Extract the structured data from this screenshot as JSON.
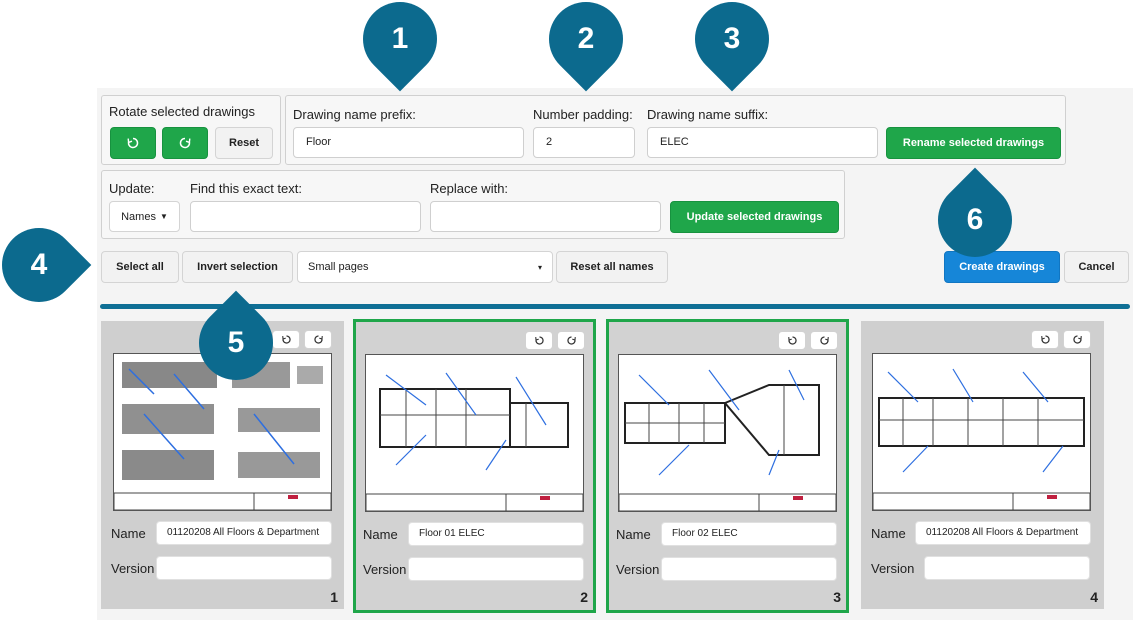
{
  "rotate": {
    "title": "Rotate selected drawings",
    "reset_label": "Reset"
  },
  "rename": {
    "prefix_label": "Drawing name prefix:",
    "prefix_value": "Floor",
    "padding_label": "Number padding:",
    "padding_value": "2",
    "suffix_label": "Drawing name suffix:",
    "suffix_value": "ELEC",
    "rename_button": "Rename selected drawings"
  },
  "update": {
    "update_label": "Update:",
    "mode_value": "Names",
    "find_label": "Find this exact text:",
    "find_value": "",
    "replace_label": "Replace with:",
    "replace_value": "",
    "update_button": "Update selected drawings"
  },
  "toolbar": {
    "select_all": "Select all",
    "invert_selection": "Invert selection",
    "page_size_value": "Small pages",
    "reset_all_names": "Reset all names",
    "create_drawings": "Create drawings",
    "cancel": "Cancel"
  },
  "cards": [
    {
      "name_label": "Name",
      "name_value": "01120208 All Floors & Department",
      "version_label": "Version",
      "version_value": "",
      "page_number": "1",
      "selected": false
    },
    {
      "name_label": "Name",
      "name_value": "Floor 01 ELEC",
      "version_label": "Version",
      "version_value": "",
      "page_number": "2",
      "selected": true
    },
    {
      "name_label": "Name",
      "name_value": "Floor 02 ELEC",
      "version_label": "Version",
      "version_value": "",
      "page_number": "3",
      "selected": true
    },
    {
      "name_label": "Name",
      "name_value": "01120208 All Floors & Department",
      "version_label": "Version",
      "version_value": "",
      "page_number": "4",
      "selected": false
    }
  ],
  "markers": [
    "1",
    "2",
    "3",
    "4",
    "5",
    "6"
  ],
  "colors": {
    "accent_green": "#1fa64a",
    "accent_blue": "#1686d8",
    "marker_teal": "#0c6a8e"
  }
}
